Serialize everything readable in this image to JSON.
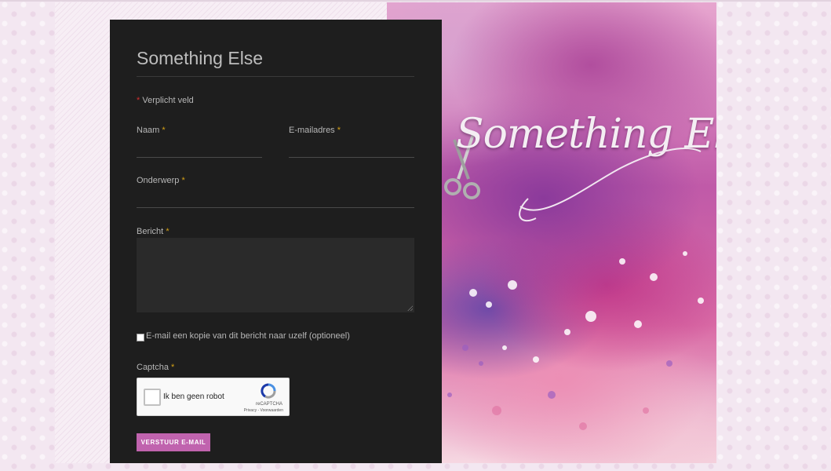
{
  "form": {
    "title": "Something Else",
    "required_note": "Verplicht veld",
    "required_marker": "*",
    "fields": {
      "name_label": "Naam",
      "email_label": "E-mailadres",
      "subject_label": "Onderwerp",
      "message_label": "Bericht"
    },
    "copy_checkbox_label": "E-mail een kopie van dit bericht naar uzelf (optioneel)",
    "captcha_label": "Captcha",
    "captcha": {
      "checkbox_text": "Ik ben geen robot",
      "brand": "reCAPTCHA",
      "links": "Privacy - Voorwaarden"
    },
    "submit_label": "VERSTUUR E-MAIL"
  },
  "logo": {
    "text": "Something Else"
  },
  "colors": {
    "panel_bg": "#1e1e1e",
    "accent_button": "#c063ae",
    "required_star": "#d4a017"
  }
}
